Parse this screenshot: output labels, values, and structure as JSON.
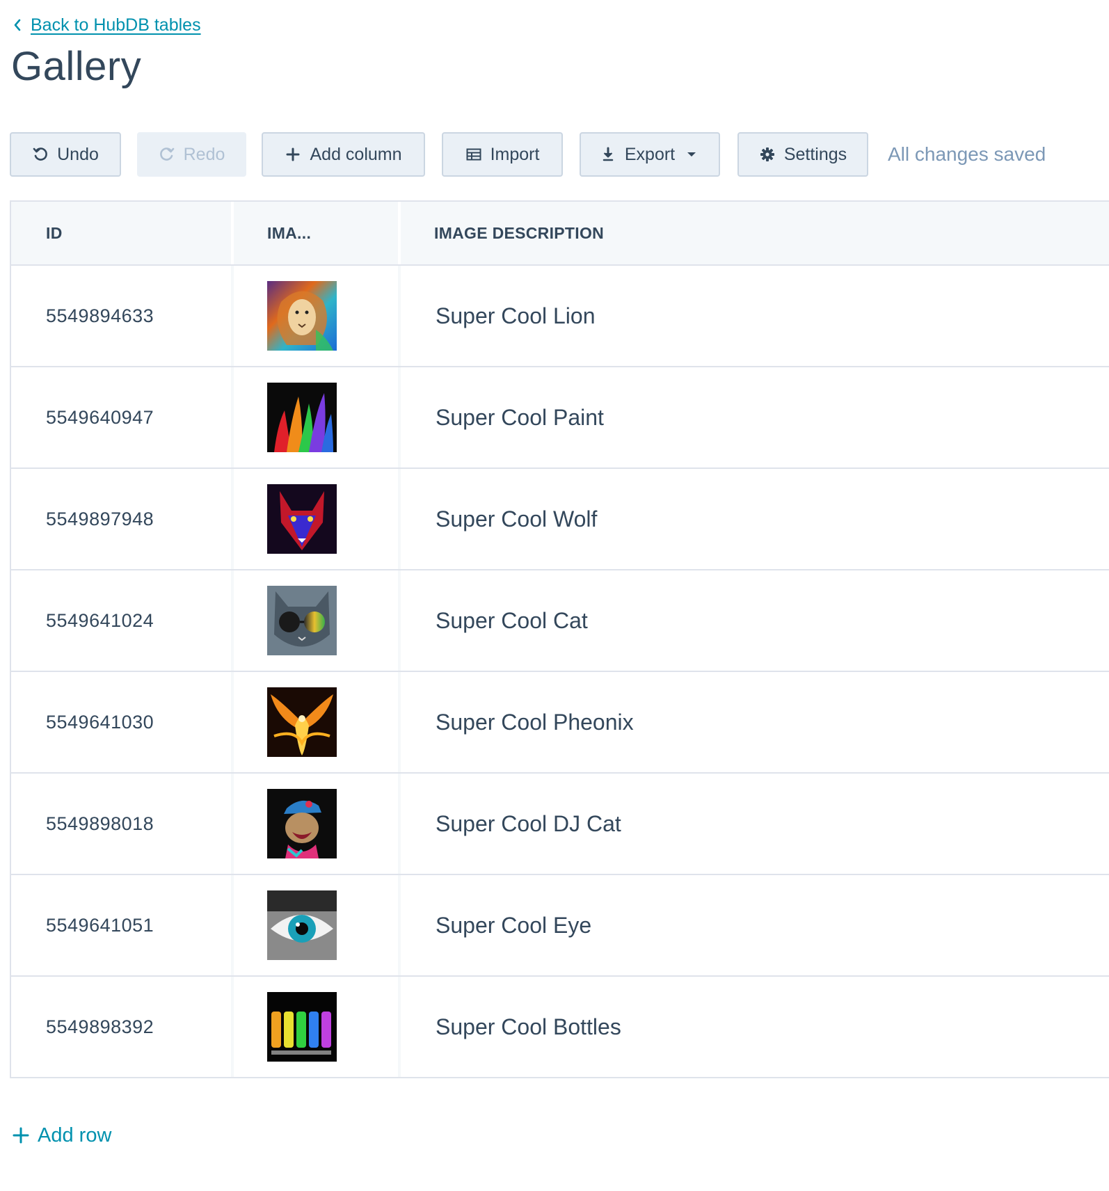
{
  "header": {
    "back_link_label": "Back to HubDB tables",
    "title": "Gallery"
  },
  "toolbar": {
    "undo_label": "Undo",
    "redo_label": "Redo",
    "add_column_label": "Add column",
    "import_label": "Import",
    "export_label": "Export",
    "settings_label": "Settings",
    "status_text": "All changes saved"
  },
  "table": {
    "columns": [
      "ID",
      "IMA...",
      "IMAGE DESCRIPTION"
    ],
    "rows": [
      {
        "id": "5549894633",
        "image_icon": "lion-image",
        "description": "Super Cool Lion"
      },
      {
        "id": "5549640947",
        "image_icon": "paint-image",
        "description": "Super Cool Paint"
      },
      {
        "id": "5549897948",
        "image_icon": "wolf-image",
        "description": "Super Cool Wolf"
      },
      {
        "id": "5549641024",
        "image_icon": "cat-image",
        "description": "Super Cool Cat"
      },
      {
        "id": "5549641030",
        "image_icon": "phoenix-image",
        "description": "Super Cool Pheonix"
      },
      {
        "id": "5549898018",
        "image_icon": "dj-cat-image",
        "description": "Super Cool DJ Cat"
      },
      {
        "id": "5549641051",
        "image_icon": "eye-image",
        "description": "Super Cool Eye"
      },
      {
        "id": "5549898392",
        "image_icon": "bottles-image",
        "description": "Super Cool Bottles"
      }
    ]
  },
  "footer": {
    "add_row_label": "Add row"
  },
  "colors": {
    "link": "#0091ae",
    "text": "#33475b",
    "button_bg": "#eaf0f6",
    "button_border": "#cbd6e2",
    "header_bg": "#f5f8fa",
    "muted": "#7c98b6"
  }
}
